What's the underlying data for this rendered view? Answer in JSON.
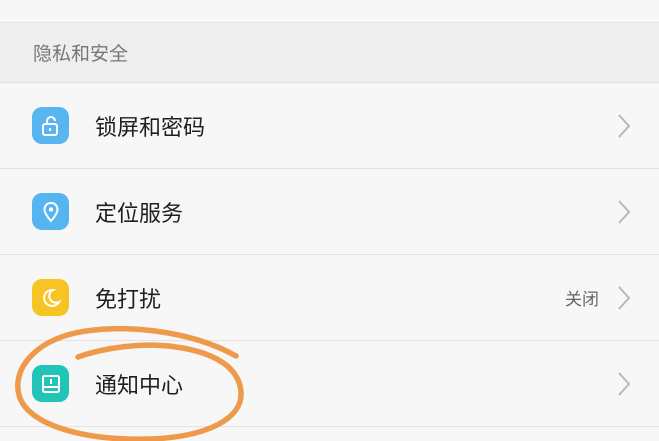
{
  "section": {
    "title": "隐私和安全"
  },
  "items": [
    {
      "label": "锁屏和密码",
      "value": "",
      "icon": "unlock-icon",
      "color": "#59b5f0"
    },
    {
      "label": "定位服务",
      "value": "",
      "icon": "location-pin-icon",
      "color": "#56b4f0"
    },
    {
      "label": "免打扰",
      "value": "关闭",
      "icon": "moon-icon",
      "color": "#f6c523"
    },
    {
      "label": "通知中心",
      "value": "",
      "icon": "notification-center-icon",
      "color": "#22c4b7"
    }
  ],
  "annotation": {
    "color": "#ee9a4a"
  }
}
